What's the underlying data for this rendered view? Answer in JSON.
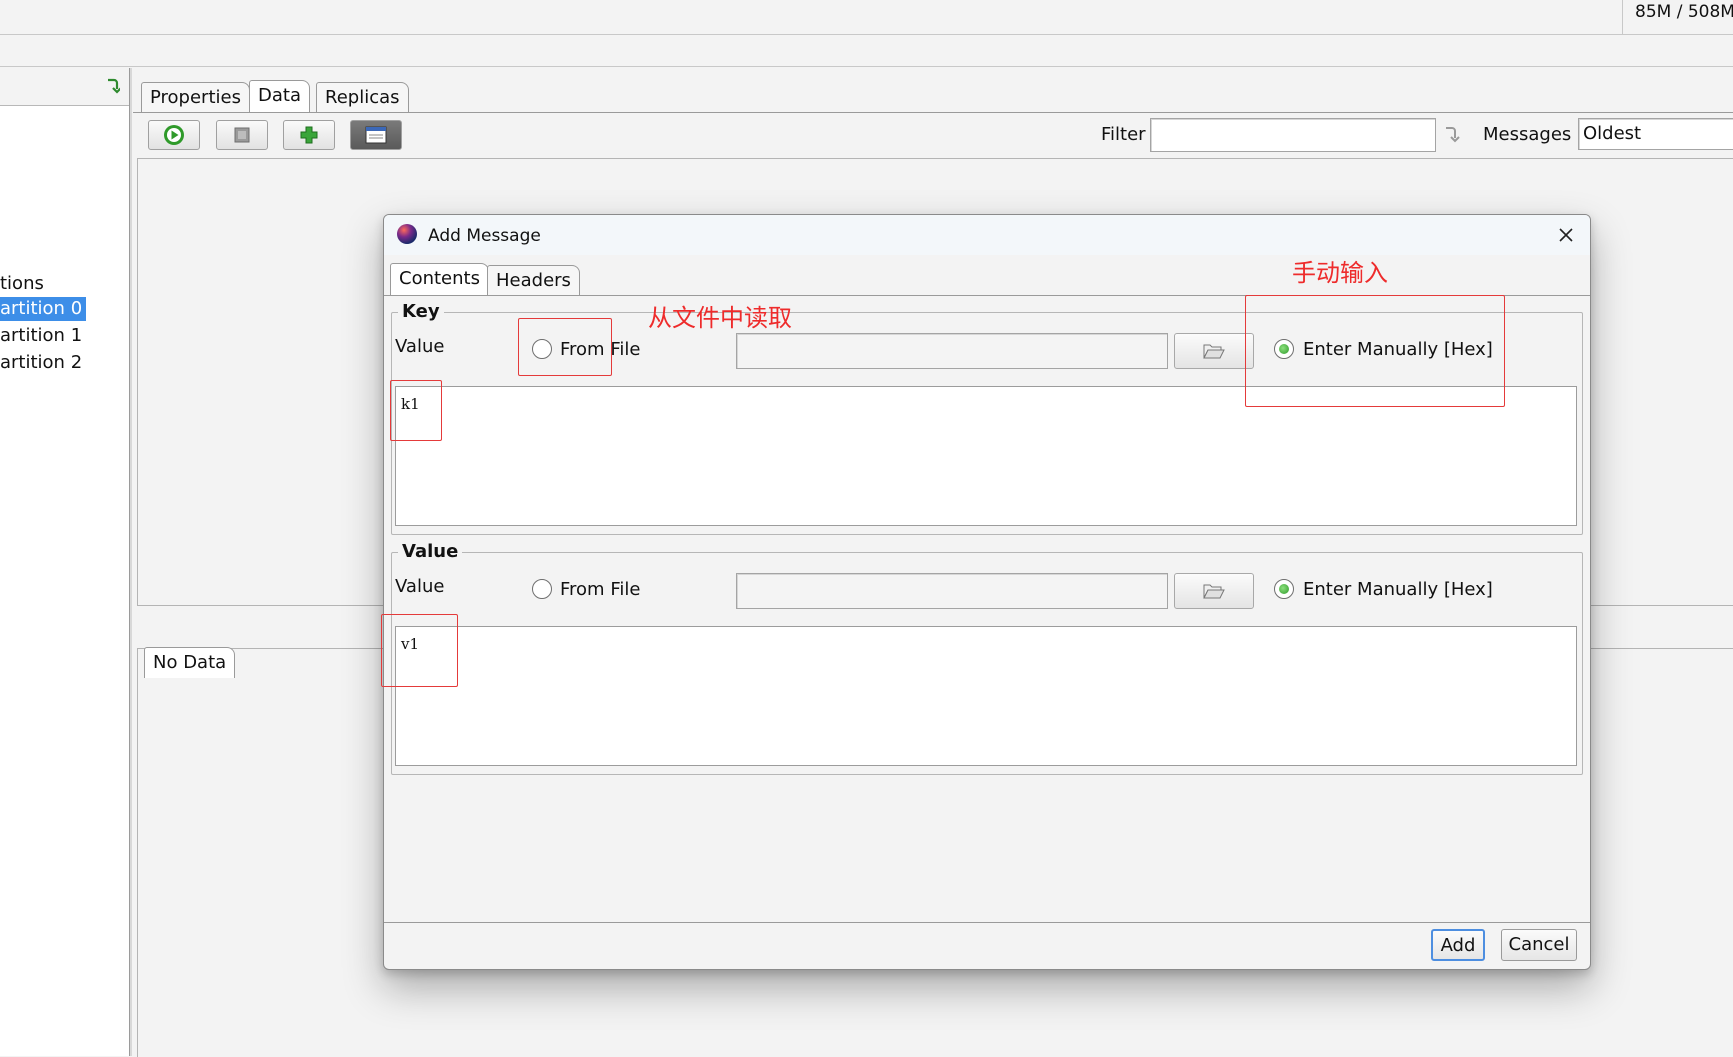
{
  "status": {
    "memory": "85M / 508M"
  },
  "left_tree": {
    "items": [
      {
        "label": "tions",
        "selected": false
      },
      {
        "label": "artition 0",
        "selected": true
      },
      {
        "label": "artition 1",
        "selected": false
      },
      {
        "label": "artition 2",
        "selected": false
      }
    ]
  },
  "main": {
    "tabs": [
      {
        "label": "Properties"
      },
      {
        "label": "Data"
      },
      {
        "label": "Replicas"
      }
    ],
    "filter_label": "Filter",
    "filter_value": "",
    "messages_label": "Messages",
    "messages_value": "Oldest",
    "lower_tab": "No Data"
  },
  "dialog": {
    "title": "Add Message",
    "tabs": [
      {
        "label": "Contents"
      },
      {
        "label": "Headers"
      }
    ],
    "key_group": {
      "legend": "Key",
      "value_label": "Value",
      "from_file_label": "From File",
      "file_path": "",
      "enter_manually_label": "Enter Manually [Hex]",
      "text": "k1"
    },
    "value_group": {
      "legend": "Value",
      "value_label": "Value",
      "from_file_label": "From File",
      "file_path": "",
      "enter_manually_label": "Enter Manually [Hex]",
      "text": "v1"
    },
    "add_label": "Add",
    "cancel_label": "Cancel"
  },
  "annotations": {
    "from_file_note": "从文件中读取",
    "manual_note": "手动输入"
  },
  "colors": {
    "selection": "#3d8ee8",
    "annotation": "#e43a3a"
  }
}
